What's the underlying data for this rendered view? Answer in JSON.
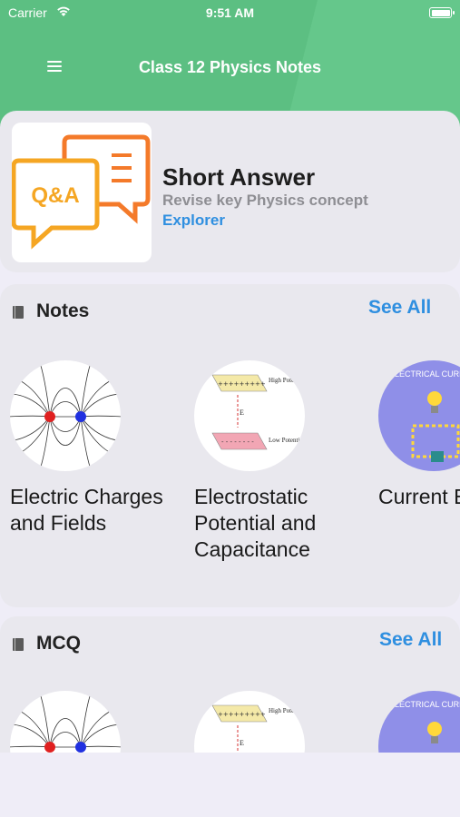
{
  "status_bar": {
    "carrier": "Carrier",
    "time": "9:51 AM",
    "wifi_icon": "wifi-icon",
    "battery_icon": "battery-icon"
  },
  "header": {
    "title": "Class 12 Physics Notes",
    "menu_icon": "hamburger-menu-icon",
    "color": "#5cbf82"
  },
  "short_answer": {
    "title": "Short Answer",
    "subtitle": "Revise key Physics concept",
    "link": "Explorer",
    "thumb_text": "Q&A",
    "thumb_color": "#f5a623"
  },
  "notes_section": {
    "title": "Notes",
    "see_all": "See All",
    "items": [
      {
        "label": "Electric Charges and Fields"
      },
      {
        "label": "Electrostatic Potential and Capacitance"
      },
      {
        "label": "Current Electric"
      }
    ]
  },
  "mcq_section": {
    "title": "MCQ",
    "see_all": "See All"
  },
  "thumb_text": {
    "high_potential": "High Potential",
    "low_potential": "Low Potential",
    "field_letter": "E",
    "electrical_current": "ELECTRICAL CURRENT"
  },
  "colors": {
    "accent": "#2f8fe0",
    "card": "#e9e8ee",
    "background": "#efedf7"
  }
}
